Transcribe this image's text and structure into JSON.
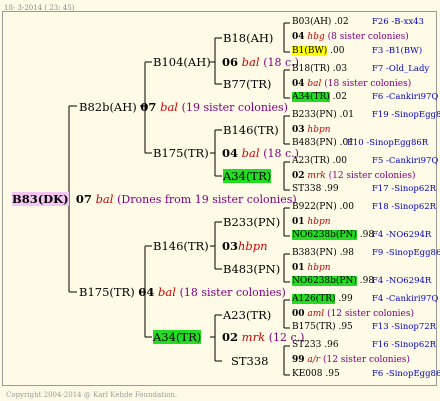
{
  "header": "18-  3-2014 ( 23: 45)",
  "footer": "Copyright 2004-2014 @ Karl Kehde Foundation.",
  "tree": {
    "root": {
      "id": "B83(DK)",
      "num": "07",
      "type": "bal",
      "colonies": "(Drones from 19 sister colonies)"
    },
    "g1": [
      {
        "id": "B82b(AH)",
        "num": "07",
        "type": "bal",
        "colonies": "(19 sister colonies)"
      },
      {
        "id": "B175(TR)",
        "num": "04",
        "type": "bal",
        "colonies": "(18 sister colonies)"
      }
    ],
    "g2": [
      {
        "id": "B104(AH)",
        "num": "06",
        "type": "bal",
        "colonies": "(18 c.)"
      },
      {
        "id": "B175(TR)",
        "num": "04",
        "type": "bal",
        "colonies": "(18 c.)"
      },
      {
        "id": "B146(TR)",
        "num": "03",
        "type": "hbpn",
        "colonies": ""
      },
      {
        "id": "A34(TR)",
        "num": "02",
        "type": "mrk",
        "colonies": "(12 c.)"
      }
    ],
    "g3": [
      {
        "id": "B18(AH)",
        "num": "04",
        "type": "hbg",
        "colonies": "(8 sister colonies)"
      },
      {
        "id": "B77(TR)",
        "num": "04",
        "type": "bal",
        "colonies": "(18 sister colonies)"
      },
      {
        "id": "B146(TR)",
        "num": "03",
        "type": "hbpn",
        "colonies": ""
      },
      {
        "id": "A34(TR)",
        "num": "02",
        "type": "mrk",
        "colonies": "(12 sister colonies)"
      },
      {
        "id": "B233(PN)",
        "num": "01",
        "type": "hbpn",
        "colonies": ""
      },
      {
        "id": "B483(PN)",
        "num": "01",
        "type": "hbpn",
        "colonies": ""
      },
      {
        "id": "A23(TR)",
        "num": "00",
        "type": "aml",
        "colonies": "(12 sister colonies)"
      },
      {
        "id": "ST338",
        "num": "99",
        "type": "a/r",
        "colonies": "(12 sister colonies)"
      }
    ],
    "g4": [
      {
        "id": "B03(AH)",
        "year": ".02",
        "src": "F26 -B-xx43"
      },
      {
        "id": "B1(BW)",
        "year": ".00",
        "src": "F3 -B1(BW)"
      },
      {
        "id": "B18(TR)",
        "year": ".03",
        "src": "F7 -Old_Lady"
      },
      {
        "id": "A34(TR)",
        "year": ".02",
        "src": "F6 -Cankiri97Q"
      },
      {
        "id": "B233(PN)",
        "year": ".01",
        "src": "F19 -SinopEgg86R"
      },
      {
        "id": "B483(PN)",
        "year": ".01",
        "src": "F10 -SinopEgg86R"
      },
      {
        "id": "A23(TR)",
        "year": ".00",
        "src": "F5 -Cankiri97Q"
      },
      {
        "id": "ST338",
        "year": ".99",
        "src": "F17 -Sinop62R"
      },
      {
        "id": "B922(PN)",
        "year": ".00",
        "src": "F18 -Sinop62R"
      },
      {
        "id": "NO6238b(PN)",
        "year": ".98",
        "src": "F4 -NO6294R"
      },
      {
        "id": "B383(PN)",
        "year": ".98",
        "src": "F9 -SinopEgg86R"
      },
      {
        "id": "NO6238b(PN)",
        "year": ".98",
        "src": "F4 -NO6294R"
      },
      {
        "id": "A126(TR)",
        "year": ".99",
        "src": "F4 -Cankiri97Q"
      },
      {
        "id": "B175(TR)",
        "year": ".95",
        "src": "F13 -Sinop72R"
      },
      {
        "id": "ST233",
        "year": ".96",
        "src": "F16 -Sinop62R"
      },
      {
        "id": "KE008",
        "year": ".95",
        "src": "F6 -SinopEgg86R"
      }
    ],
    "g3_extra": [
      {
        "id": "B146(TR)"
      },
      {
        "id": "A34(TR)"
      }
    ]
  }
}
